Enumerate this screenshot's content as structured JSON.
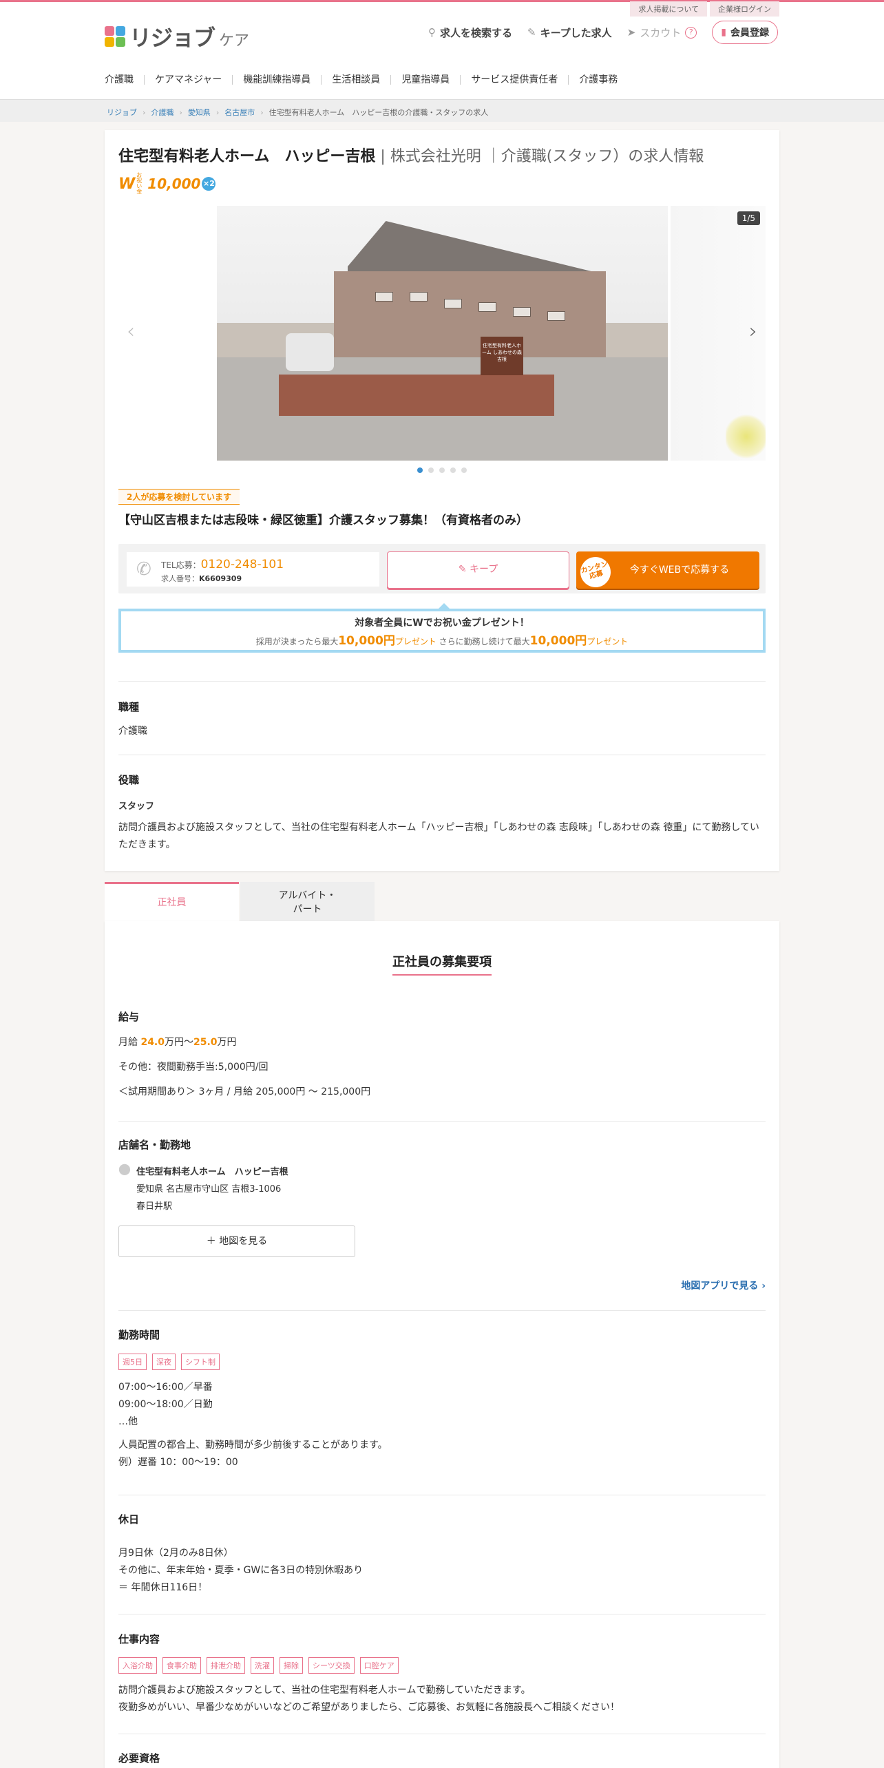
{
  "top_links": [
    "求人掲載について",
    "企業様ログイン"
  ],
  "logo": {
    "text": "リジョブ",
    "sub": "ケア",
    "colors": [
      "#e9728b",
      "#44a8e0",
      "#f0b400",
      "#6cbf54"
    ]
  },
  "header_nav": {
    "search": "求人を検索する",
    "kept": "キープした求人",
    "scout": "スカウト",
    "scout_help": "?",
    "signup": "会員登録"
  },
  "categories": [
    "介護職",
    "ケアマネジャー",
    "機能訓練指導員",
    "生活相談員",
    "児童指導員",
    "サービス提供責任者",
    "介護事務"
  ],
  "breadcrumb": [
    "リジョブ",
    "介護職",
    "愛知県",
    "名古屋市",
    "住宅型有料老人ホーム　ハッピー吉根の介護職・スタッフの求人"
  ],
  "job": {
    "facility": "住宅型有料老人ホーム　ハッピー吉根",
    "company_suffix": " | 株式会社光明 ｜介護職(スタッフ）の求人情報",
    "bonus": {
      "w": "W",
      "small": "お祝い金",
      "amount": "10,000",
      "x2": "×2"
    },
    "gallery_counter": "1/5",
    "sign_text": "住宅型有料老人ホーム しあわせの森 吉根",
    "applicants": "2人が応募を検討しています",
    "headline": "【守山区吉根または志段味・緑区徳重】介護スタッフ募集！（有資格者のみ）",
    "tel_label": "TEL応募：",
    "tel": "0120-248-101",
    "id_label": "求人番号：",
    "id": "K6609309",
    "keep_btn": "キープ",
    "web_stamp": "カンタン応募",
    "web_btn": "今すぐWEBで応募する",
    "gift_title": "対象者全員にWでお祝い金プレゼント！",
    "gift_a": "採用が決まったら最大",
    "gift_amt1": "10,000円",
    "gift_b": "プレゼント",
    "gift_c": " さらに勤務し続けて最大",
    "gift_amt2": "10,000円",
    "gift_d": "プレゼント"
  },
  "section_shokushu": {
    "title": "職種",
    "value": "介護職"
  },
  "section_yakushoku": {
    "title": "役職",
    "subtitle": "スタッフ",
    "body": "訪問介護員および施設スタッフとして、当社の住宅型有料老人ホーム「ハッピー吉根」「しあわせの森 志段味」「しあわせの森 徳重」にて勤務していただきます。"
  },
  "tabs": {
    "fulltime": "正社員",
    "part1": "アルバイト・",
    "part2": "パート"
  },
  "requirements": {
    "title": "正社員の募集要項",
    "salary_title": "給与",
    "salary_pre": "月給 ",
    "salary_min": "24.0",
    "salary_mid": "万円〜",
    "salary_max": "25.0",
    "salary_post": "万円",
    "salary_other": "その他：夜間勤務手当:5,000円/回",
    "salary_trial": "＜試用期間あり＞ 3ヶ月 / 月給 205,000円 〜 215,000円",
    "place_title": "店舗名・勤務地",
    "place_name": "住宅型有料老人ホーム　ハッピー吉根",
    "place_addr": "愛知県 名古屋市守山区 吉根3-1006",
    "place_station": "春日井駅",
    "map_btn": "＋ 地図を見る",
    "map_app": "地図アプリで見る ›",
    "hours_title": "勤務時間",
    "hours_tags": [
      "週5日",
      "深夜",
      "シフト制"
    ],
    "hours_lines": [
      "07:00〜16:00／早番",
      "09:00〜18:00／日勤",
      "…他"
    ],
    "hours_note1": "人員配置の都合上、勤務時間が多少前後することがあります。",
    "hours_note2": "例）遅番 10：00～19：00",
    "holiday_title": "休日",
    "holiday_lines": [
      "月9日休（2月のみ8日休）",
      "その他に、年末年始・夏季・GWに各3日の特別休暇あり",
      "＝ 年間休日116日！"
    ],
    "work_title": "仕事内容",
    "work_tags": [
      "入浴介助",
      "食事介助",
      "排泄介助",
      "洗濯",
      "掃除",
      "シーツ交換",
      "口腔ケア"
    ],
    "work_line1": "訪問介護員および施設スタッフとして、当社の住宅型有料老人ホームで勤務していただきます。",
    "work_line2": "夜勤多めがいい、早番少なめがいいなどのご希望がありましたら、ご応募後、お気軽に各施設長へご相談ください！",
    "req_title": "必要資格"
  }
}
